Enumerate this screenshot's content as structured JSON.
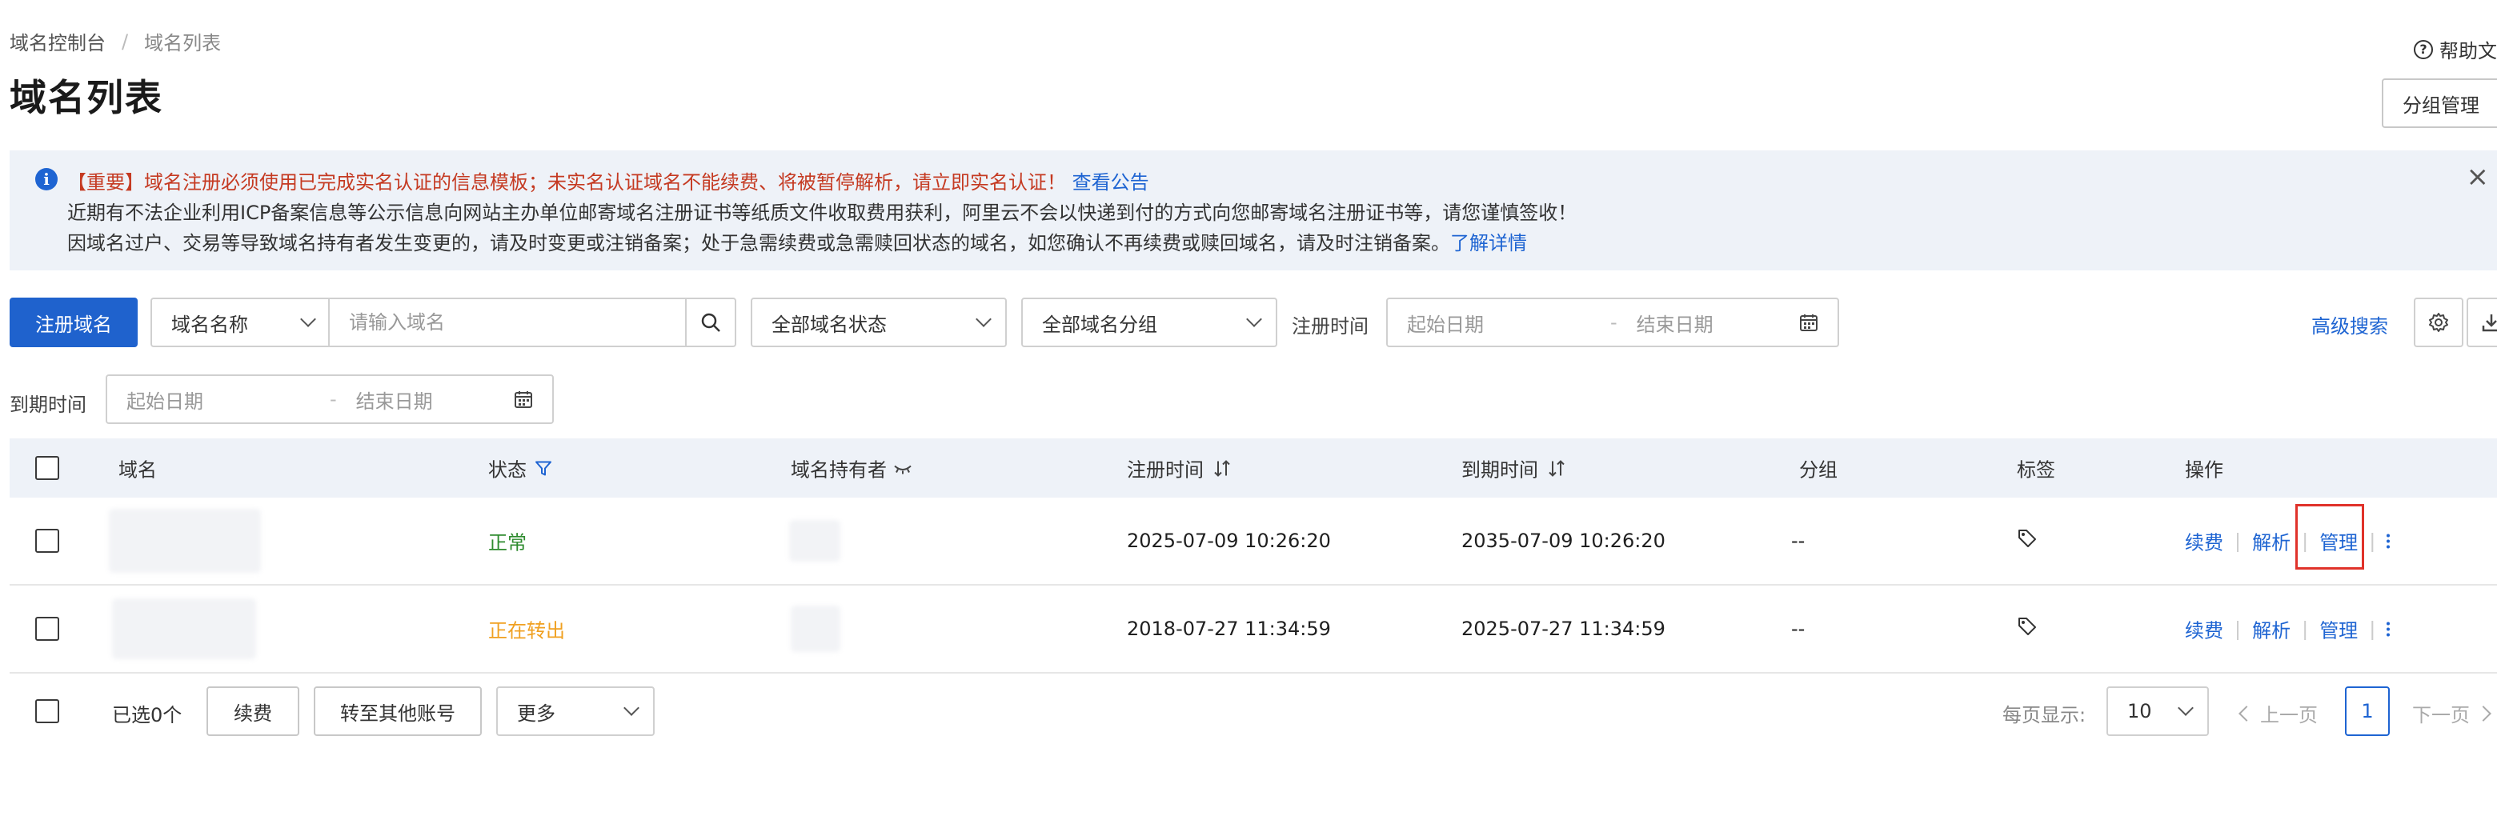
{
  "breadcrumb": {
    "root": "域名控制台",
    "separator": "/",
    "current": "域名列表"
  },
  "page_title": "域名列表",
  "help_label": "帮助文",
  "group_manage_label": "分组管理",
  "notice": {
    "line1_warning": "【重要】域名注册必须使用已完成实名认证的信息模板；未实名认证域名不能续费、将被暂停解析，请立即实名认证！",
    "line1_link": "查看公告",
    "line2": "近期有不法企业利用ICP备案信息等公示信息向网站主办单位邮寄域名注册证书等纸质文件收取费用获利，阿里云不会以快递到付的方式向您邮寄域名注册证书等，请您谨慎签收！",
    "line3": "因域名过户、交易等导致域名持有者发生变更的，请及时变更或注销备案；处于急需续费或急需赎回状态的域名，如您确认不再续费或赎回域名，请及时注销备案。",
    "line3_link": "了解详情"
  },
  "toolbar": {
    "register_label": "注册域名",
    "search_field_select": "域名名称",
    "search_placeholder": "请输入域名",
    "status_filter": "全部域名状态",
    "group_filter": "全部域名分组",
    "reg_time_label": "注册时间",
    "start_date_placeholder": "起始日期",
    "end_date_placeholder": "结束日期",
    "date_dash": "-",
    "advanced_search": "高级搜索",
    "expire_time_label": "到期时间"
  },
  "table": {
    "headers": {
      "domain": "域名",
      "status": "状态",
      "holder": "域名持有者",
      "reg_time": "注册时间",
      "expire_time": "到期时间",
      "group": "分组",
      "tag": "标签",
      "actions": "操作"
    },
    "rows": [
      {
        "status": "正常",
        "reg_time": "2025-07-09 10:26:20",
        "expire_time": "2035-07-09 10:26:20",
        "group": "--",
        "renew": "续费",
        "resolve": "解析",
        "manage": "管理"
      },
      {
        "status": "正在转出",
        "reg_time": "2018-07-27 11:34:59",
        "expire_time": "2025-07-27 11:34:59",
        "group": "--",
        "renew": "续费",
        "resolve": "解析",
        "manage": "管理"
      }
    ]
  },
  "footer": {
    "selected_count": "已选0个",
    "renew_label": "续费",
    "transfer_label": "转至其他账号",
    "more_label": "更多",
    "page_size_label": "每页显示:",
    "page_size": "10",
    "prev_label": "上一页",
    "current_page": "1",
    "next_label": "下一页"
  },
  "colors": {
    "primary": "#1f62cd",
    "link": "#1e64d2",
    "warning": "#c53a22",
    "normal": "#2e8b2e",
    "transfer": "#f0a020",
    "highlight": "#e0322a"
  },
  "icons": [
    "help-icon",
    "info-icon",
    "close-icon",
    "chevron-down-icon",
    "search-icon",
    "calendar-icon",
    "gear-icon",
    "download-icon",
    "filter-icon",
    "eye-closed-icon",
    "sort-icon",
    "tag-icon",
    "more-vertical-icon",
    "chevron-left-icon",
    "chevron-right-icon"
  ]
}
